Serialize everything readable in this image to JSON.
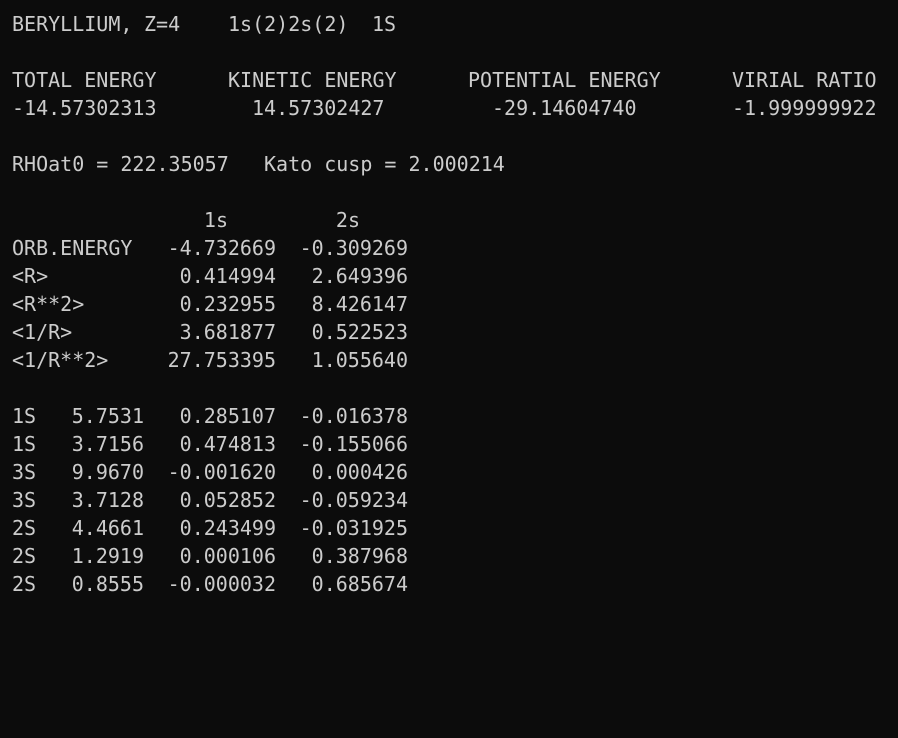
{
  "header": {
    "element": "BERYLLIUM,",
    "atomic_number": "Z=4",
    "configuration": "1s(2)2s(2)",
    "term": "1S"
  },
  "energies": {
    "labels": [
      "TOTAL ENERGY",
      "KINETIC ENERGY",
      "POTENTIAL ENERGY",
      "VIRIAL RATIO"
    ],
    "values": [
      "-14.57302313",
      "14.57302427",
      "-29.14604740",
      "-1.999999922"
    ]
  },
  "density": {
    "rho_at_0": "RHOat0 = 222.35057",
    "kato_cusp": "Kato cusp = 2.000214"
  },
  "orbital_table": {
    "columns": [
      "1s",
      "2s"
    ],
    "rows": [
      {
        "label": "ORB.ENERGY",
        "values": [
          "-4.732669",
          "-0.309269"
        ]
      },
      {
        "label": "<R>",
        "values": [
          "0.414994",
          "2.649396"
        ]
      },
      {
        "label": "<R**2>",
        "values": [
          "0.232955",
          "8.426147"
        ]
      },
      {
        "label": "<1/R>",
        "values": [
          "3.681877",
          "0.522523"
        ]
      },
      {
        "label": "<1/R**2>",
        "values": [
          "27.753395",
          "1.055640"
        ]
      }
    ]
  },
  "basis_table": {
    "rows": [
      {
        "type": "1S",
        "exponent": "5.7531",
        "c1": "0.285107",
        "c2": "-0.016378"
      },
      {
        "type": "1S",
        "exponent": "3.7156",
        "c1": "0.474813",
        "c2": "-0.155066"
      },
      {
        "type": "3S",
        "exponent": "9.9670",
        "c1": "-0.001620",
        "c2": "0.000426"
      },
      {
        "type": "3S",
        "exponent": "3.7128",
        "c1": "0.052852",
        "c2": "-0.059234"
      },
      {
        "type": "2S",
        "exponent": "4.4661",
        "c1": "0.243499",
        "c2": "-0.031925"
      },
      {
        "type": "2S",
        "exponent": "1.2919",
        "c1": "0.000106",
        "c2": "0.387968"
      },
      {
        "type": "2S",
        "exponent": "0.8555",
        "c1": "-0.000032",
        "c2": "0.685674"
      }
    ]
  }
}
